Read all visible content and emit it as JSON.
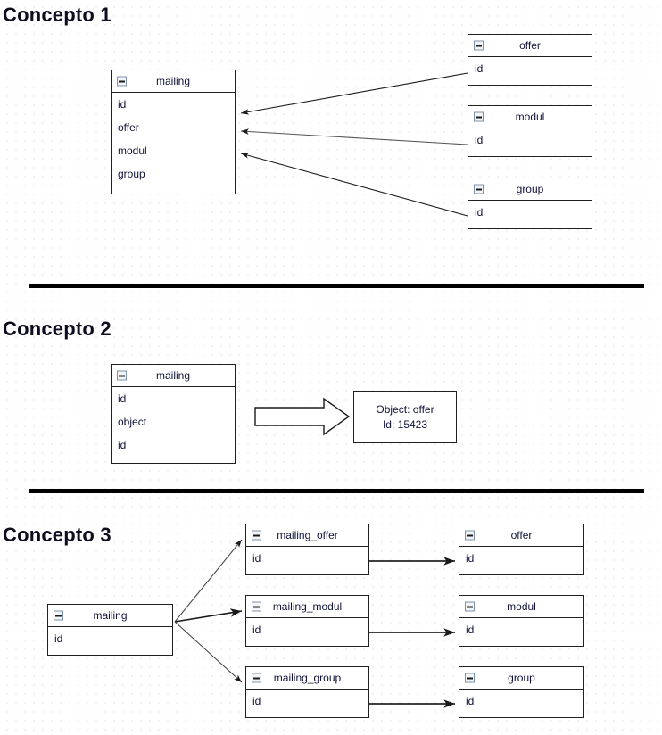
{
  "sections": [
    {
      "title": "Concepto 1"
    },
    {
      "title": "Concepto 2"
    },
    {
      "title": "Concepto 3"
    }
  ],
  "concepto1": {
    "mailing": {
      "name": "mailing",
      "icon": "collapse-minus-icon",
      "rows": [
        "id",
        "offer",
        "modul",
        "group"
      ]
    },
    "targets": [
      {
        "name": "offer",
        "icon": "collapse-minus-icon",
        "rows": [
          "id"
        ]
      },
      {
        "name": "modul",
        "icon": "collapse-minus-icon",
        "rows": [
          "id"
        ]
      },
      {
        "name": "group",
        "icon": "collapse-minus-icon",
        "rows": [
          "id"
        ]
      }
    ]
  },
  "concepto2": {
    "mailing": {
      "name": "mailing",
      "icon": "collapse-minus-icon",
      "rows": [
        "id",
        "object",
        "id"
      ]
    },
    "note": {
      "line1": "Object: offer",
      "line2": "Id: 15423"
    }
  },
  "concepto3": {
    "mailing": {
      "name": "mailing",
      "icon": "collapse-minus-icon",
      "rows": [
        "id"
      ]
    },
    "junctions": [
      {
        "name": "mailing_offer",
        "icon": "collapse-minus-icon",
        "rows": [
          "id"
        ]
      },
      {
        "name": "mailing_modul",
        "icon": "collapse-minus-icon",
        "rows": [
          "id"
        ]
      },
      {
        "name": "mailing_group",
        "icon": "collapse-minus-icon",
        "rows": [
          "id"
        ]
      }
    ],
    "targets": [
      {
        "name": "offer",
        "icon": "collapse-minus-icon",
        "rows": [
          "id"
        ]
      },
      {
        "name": "modul",
        "icon": "collapse-minus-icon",
        "rows": [
          "id"
        ]
      },
      {
        "name": "group",
        "icon": "collapse-minus-icon",
        "rows": [
          "id"
        ]
      }
    ]
  },
  "colors": {
    "background": "#ffffff",
    "grid_dot": "#c9c9c9",
    "box_border": "#202020",
    "text": "#12123a",
    "title": "#0d0d1f",
    "divider": "#000000",
    "icon_border": "#7d93ad"
  }
}
